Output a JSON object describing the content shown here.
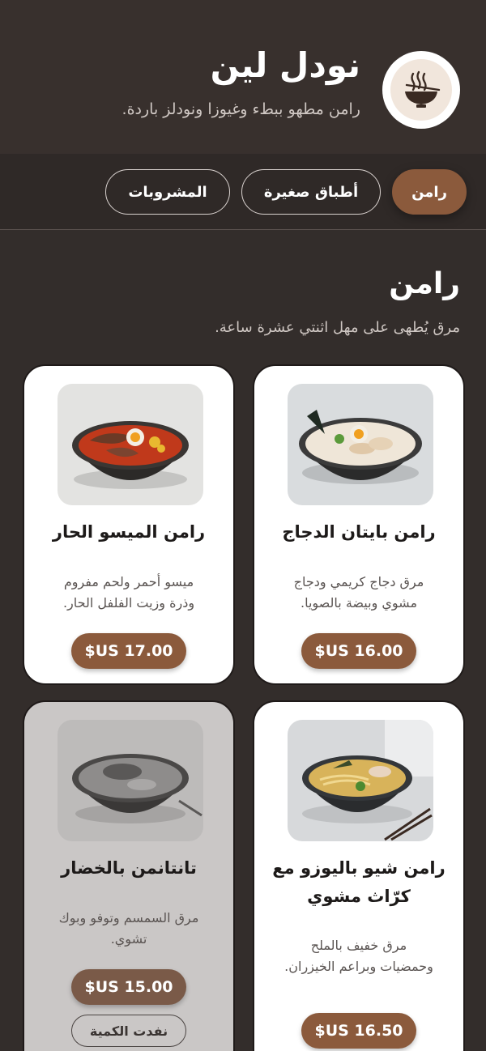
{
  "header": {
    "title": "نودل لين",
    "subtitle": "رامن مطهو ببطء وغيوزا ونودلز باردة.",
    "logo_icon": "ramen-bowl-icon"
  },
  "tabs": [
    {
      "label": "رامن",
      "active": true
    },
    {
      "label": "أطباق صغيرة",
      "active": false
    },
    {
      "label": "المشروبات",
      "active": false
    }
  ],
  "section": {
    "title": "رامن",
    "subtitle": "مرق يُطهى على مهل اثنتي عشرة ساعة."
  },
  "items": [
    {
      "name": "رامن بايتان الدجاج",
      "desc_line1": "مرق دجاج كريمي ودجاج",
      "desc_line2": "مشوي وبيضة بالصويا.",
      "price": "$US 16.00",
      "sold_out": false
    },
    {
      "name": "رامن الميسو الحار",
      "desc_line1": "ميسو أحمر ولحم مفروم",
      "desc_line2": "وذرة وزيت الفلفل الحار.",
      "price": "$US 17.00",
      "sold_out": false
    },
    {
      "name_line1": "رامن شيو باليوزو مع",
      "name_line2": "كرّاث مشوي",
      "desc_line1": "مرق خفيف بالملح",
      "desc_line2": "وحمضيات وبراعم الخيزران.",
      "price": "$US 16.50",
      "sold_out": false
    },
    {
      "name": "تانتانمن بالخضار",
      "desc_line1": "مرق السمسم وتوفو وبوك",
      "desc_line2": "تشوي.",
      "price": "$US 15.00",
      "sold_out": true,
      "sold_label": "نفدت الكمية"
    }
  ],
  "colors": {
    "accent": "#8b5a3c",
    "background": "#332d2b",
    "card": "#ffffff"
  }
}
